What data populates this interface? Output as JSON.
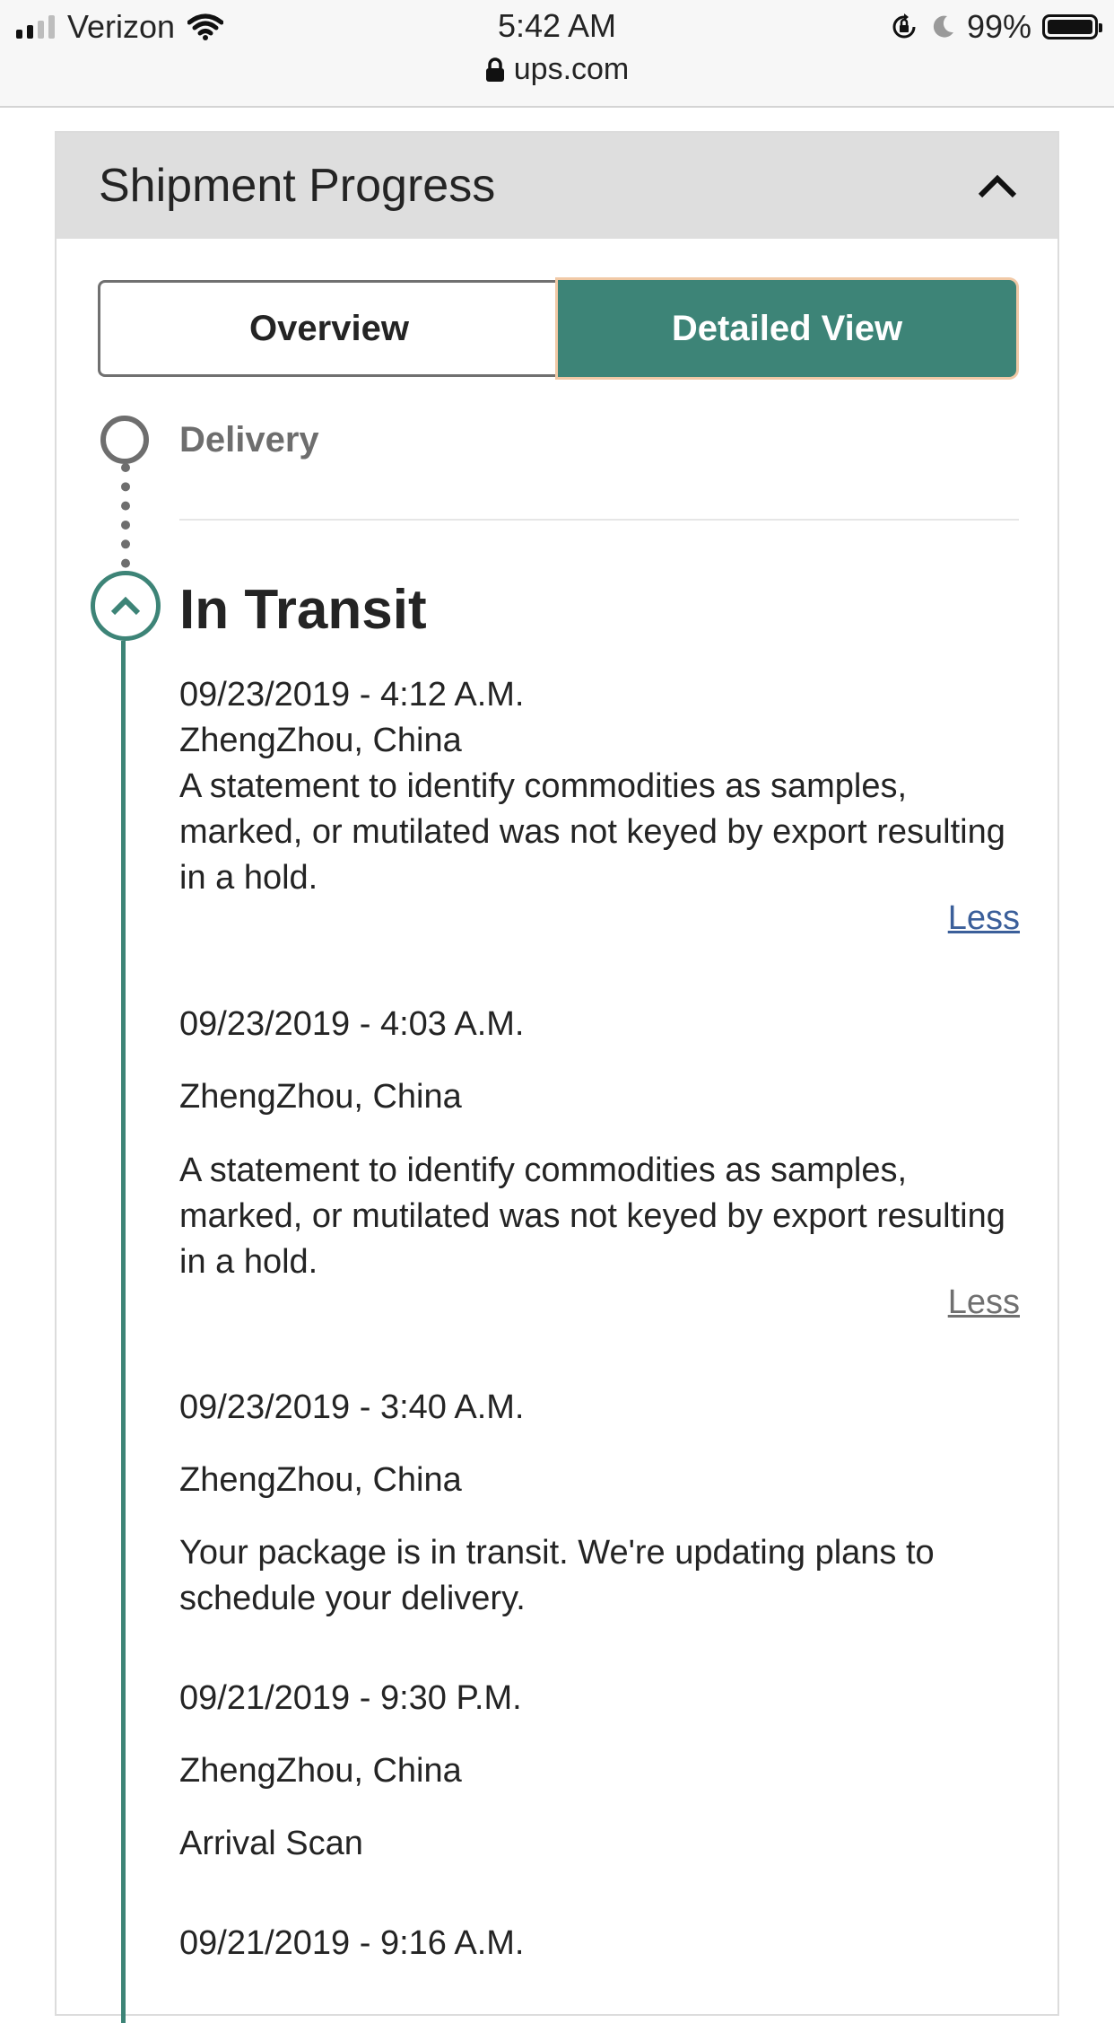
{
  "status_bar": {
    "carrier": "Verizon",
    "time": "5:42 AM",
    "battery": "99%",
    "battery_level": 0.99,
    "url": "ups.com"
  },
  "panel": {
    "title": "Shipment Progress",
    "tabs": {
      "overview": "Overview",
      "detailed": "Detailed View",
      "selected": "Detailed View"
    }
  },
  "timeline": {
    "upcoming_label": "Delivery",
    "current_status": "In Transit",
    "events": [
      {
        "datetime": "09/23/2019 - 4:12 A.M.",
        "location": "ZhengZhou, China",
        "description": "A statement to identify commodities as samples, marked, or mutilated was not keyed by export resulting in a hold.",
        "toggle": "Less"
      },
      {
        "datetime": "09/23/2019 - 4:03 A.M.",
        "location": "ZhengZhou, China",
        "description": "A statement to identify commodities as samples, marked, or mutilated was not keyed by export resulting in a hold.",
        "toggle": "Less"
      },
      {
        "datetime": "09/23/2019 - 3:40 A.M.",
        "location": "ZhengZhou, China",
        "description": "Your package is in transit. We're updating plans to schedule your delivery."
      },
      {
        "datetime": "09/21/2019 - 9:30 P.M.",
        "location": "ZhengZhou, China",
        "description": "Arrival Scan"
      },
      {
        "datetime": "09/21/2019 - 9:16 A.M."
      }
    ]
  },
  "colors": {
    "accent": "#3d8477",
    "link": "#3b5f9a",
    "muted": "#6e6e6e"
  }
}
